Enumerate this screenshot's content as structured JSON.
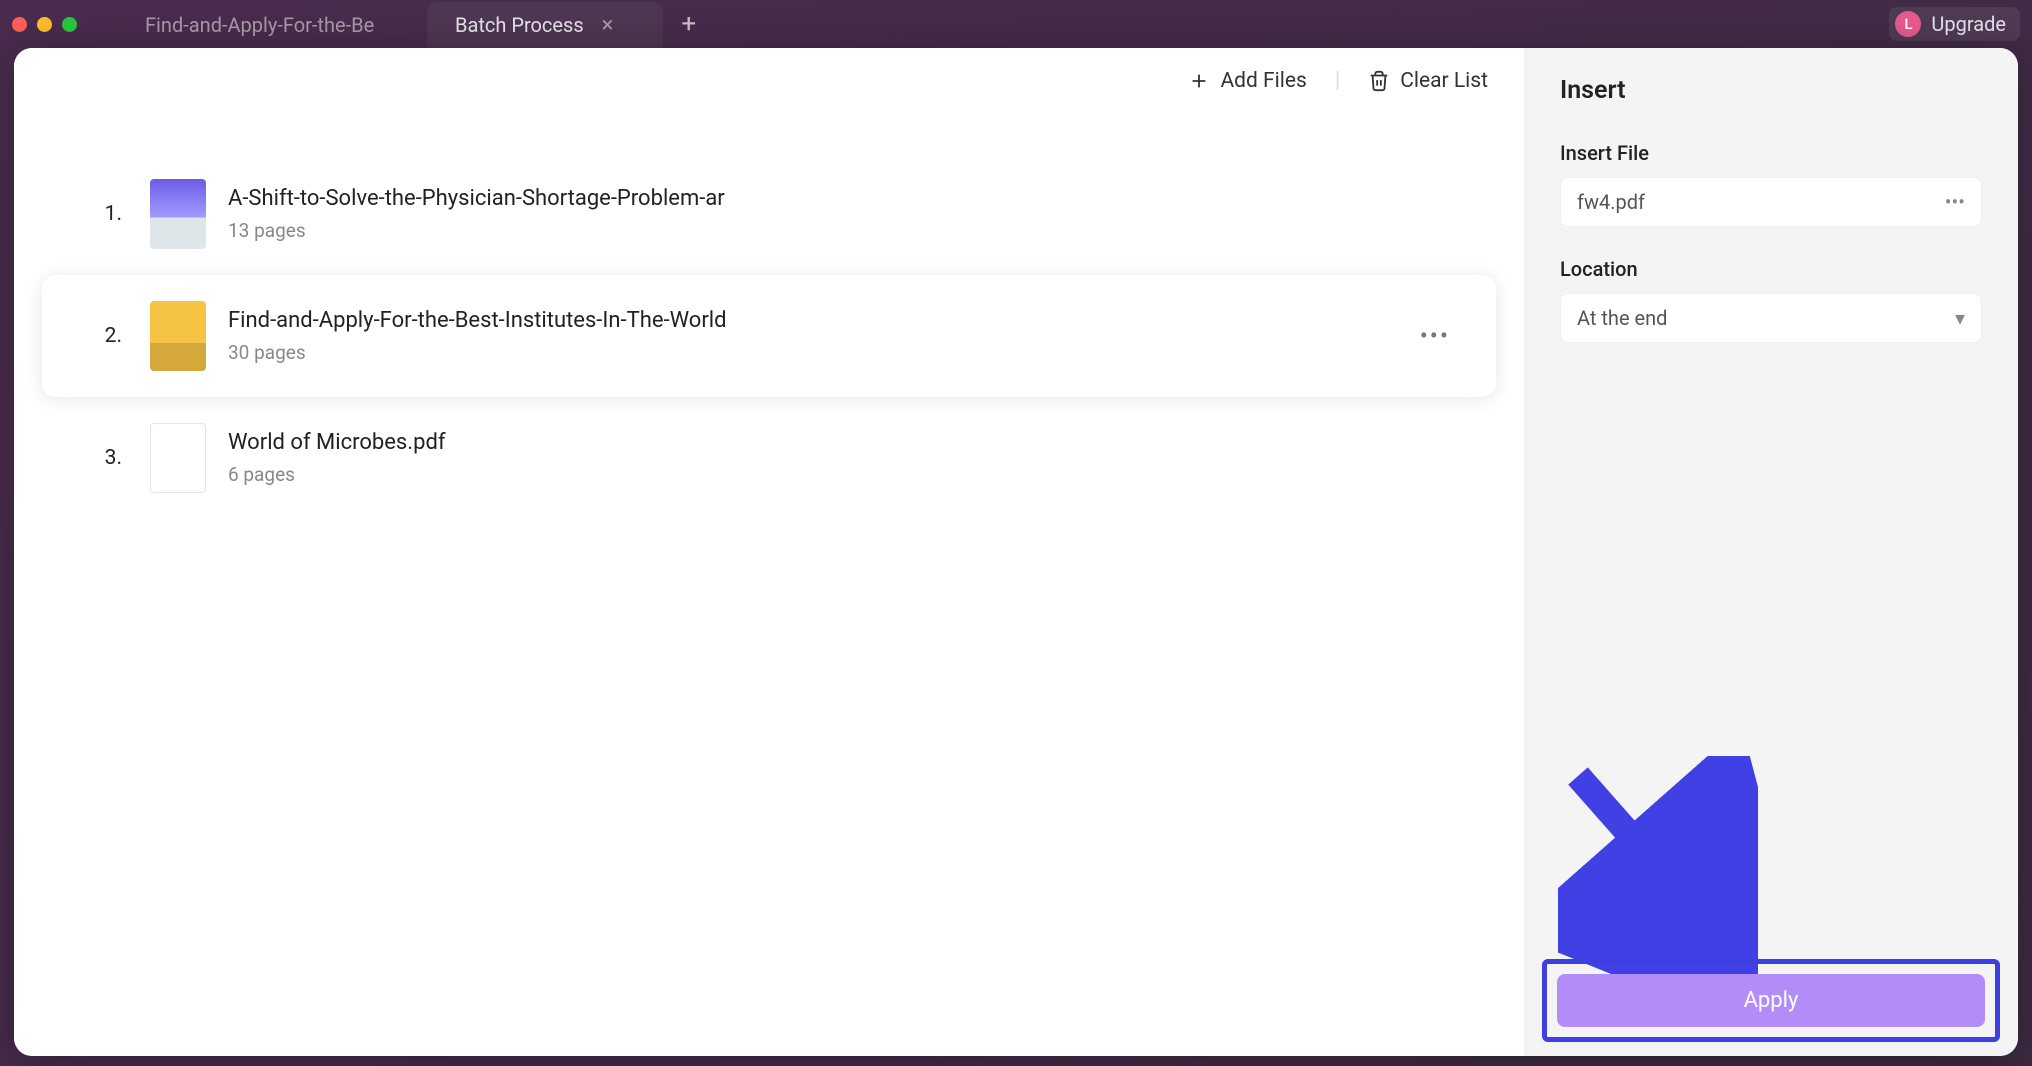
{
  "titlebar": {
    "tabs": [
      {
        "label": "Find-and-Apply-For-the-Be",
        "active": false
      },
      {
        "label": "Batch Process",
        "active": true
      }
    ],
    "upgrade_label": "Upgrade",
    "avatar_initial": "L"
  },
  "toolbar": {
    "add_files_label": "Add Files",
    "clear_list_label": "Clear List"
  },
  "files": [
    {
      "index": "1.",
      "name": "A-Shift-to-Solve-the-Physician-Shortage-Problem-ar",
      "pages": "13 pages",
      "selected": false
    },
    {
      "index": "2.",
      "name": "Find-and-Apply-For-the-Best-Institutes-In-The-World",
      "pages": "30 pages",
      "selected": true
    },
    {
      "index": "3.",
      "name": "World of Microbes.pdf",
      "pages": "6 pages",
      "selected": false
    }
  ],
  "side": {
    "title": "Insert",
    "insert_file_label": "Insert File",
    "insert_file_value": "fw4.pdf",
    "location_label": "Location",
    "location_value": "At the end",
    "apply_label": "Apply"
  },
  "colors": {
    "accent": "#b38df7",
    "highlight_border": "#3e3fe3",
    "arrow": "#4040e5"
  }
}
